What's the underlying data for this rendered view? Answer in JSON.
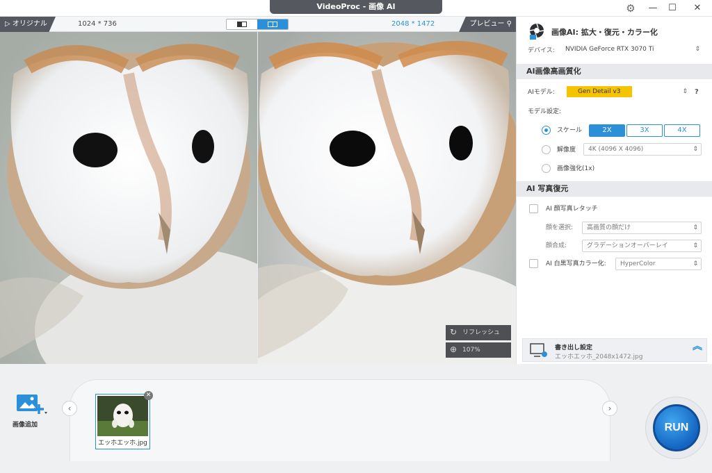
{
  "window": {
    "title": "VideoProc - 画像 AI"
  },
  "preview": {
    "original_label": "▷ オリジナル",
    "original_size": "1024 * 736",
    "output_size": "2048 * 1472",
    "preview_label": "プレビュー",
    "refresh_label": "リフレッシュ",
    "zoom_label": "107%"
  },
  "panel": {
    "title": "画像AI: 拡大・復元・カラー化",
    "device_label": "デバイス:",
    "device_value": "NVIDIA GeForce RTX 3070 Ti",
    "section_upscale": "AI画像高画質化",
    "model_label": "AIモデル:",
    "model_value": "Gen Detail v3",
    "help": "?",
    "model_settings_label": "モデル設定:",
    "scale_label": "スケール",
    "scale_options": [
      "2X",
      "3X",
      "4X"
    ],
    "scale_selected": "2X",
    "resolution_label": "解像度",
    "resolution_value": "4K (4096 X 4096)",
    "enhance_label": "画像強化(1x)",
    "section_restore": "AI 写真復元",
    "face_label": "AI 顔写真レタッチ",
    "face_select_label": "顔を選択:",
    "face_select_value": "高画質の顔だけ",
    "face_blend_label": "顔合成:",
    "face_blend_value": "グラデーションオーバーレイ",
    "colorize_label": "AI 白黒写真カラー化:",
    "colorize_value": "HyperColor",
    "export_title": "書き出し設定",
    "export_file": "エッホエッホ_2048x1472.jpg"
  },
  "bottom": {
    "add_label": "画像追加",
    "thumb_name": "エッホエッホ.jpg",
    "run_label": "RUN"
  },
  "colors": {
    "accent": "#2b90d9",
    "model_chip": "#f4c400",
    "dark_tag": "#55585e"
  }
}
